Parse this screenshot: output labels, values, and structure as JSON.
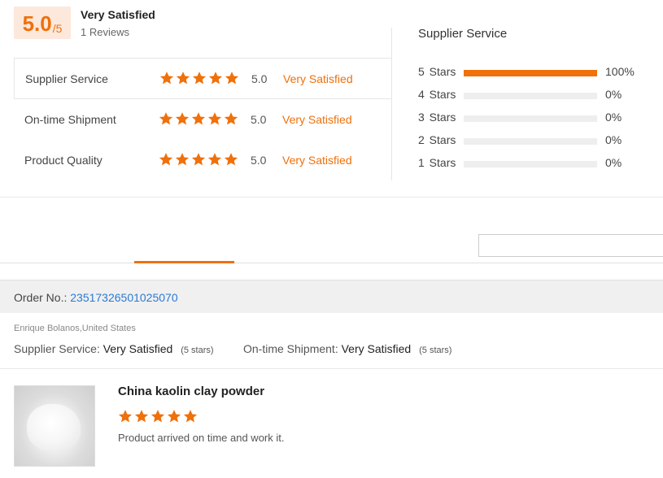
{
  "summary": {
    "score": "5.0",
    "score_out_of": "/5",
    "title": "Very Satisfied",
    "reviews": "1 Reviews"
  },
  "ratings": [
    {
      "label": "Supplier Service",
      "score": "5.0",
      "verdict": "Very Satisfied",
      "stars": 5
    },
    {
      "label": "On-time Shipment",
      "score": "5.0",
      "verdict": "Very Satisfied",
      "stars": 5
    },
    {
      "label": "Product Quality",
      "score": "5.0",
      "verdict": "Very Satisfied",
      "stars": 5
    }
  ],
  "distribution": {
    "title": "Supplier Service",
    "rows": [
      {
        "label": "5 Stars",
        "percent": 100,
        "text": "100%"
      },
      {
        "label": "4 Stars",
        "percent": 0,
        "text": "0%"
      },
      {
        "label": "3 Stars",
        "percent": 0,
        "text": "0%"
      },
      {
        "label": "2 Stars",
        "percent": 0,
        "text": "0%"
      },
      {
        "label": "1 Stars",
        "percent": 0,
        "text": "0%"
      }
    ]
  },
  "order": {
    "label": "Order No.:",
    "number": "23517326501025070"
  },
  "review": {
    "reviewer": "Enrique Bolanos,United States",
    "supplier_label": "Supplier Service:",
    "supplier_value": "Very Satisfied",
    "supplier_stars": "(5 stars)",
    "shipment_label": "On-time Shipment:",
    "shipment_value": "Very Satisfied",
    "shipment_stars": "(5 stars)",
    "product_title": "China kaolin clay powder",
    "product_stars": 5,
    "comment": "Product arrived on time and work it."
  },
  "colors": {
    "accent": "#f0700a",
    "link": "#2a7ad5"
  }
}
